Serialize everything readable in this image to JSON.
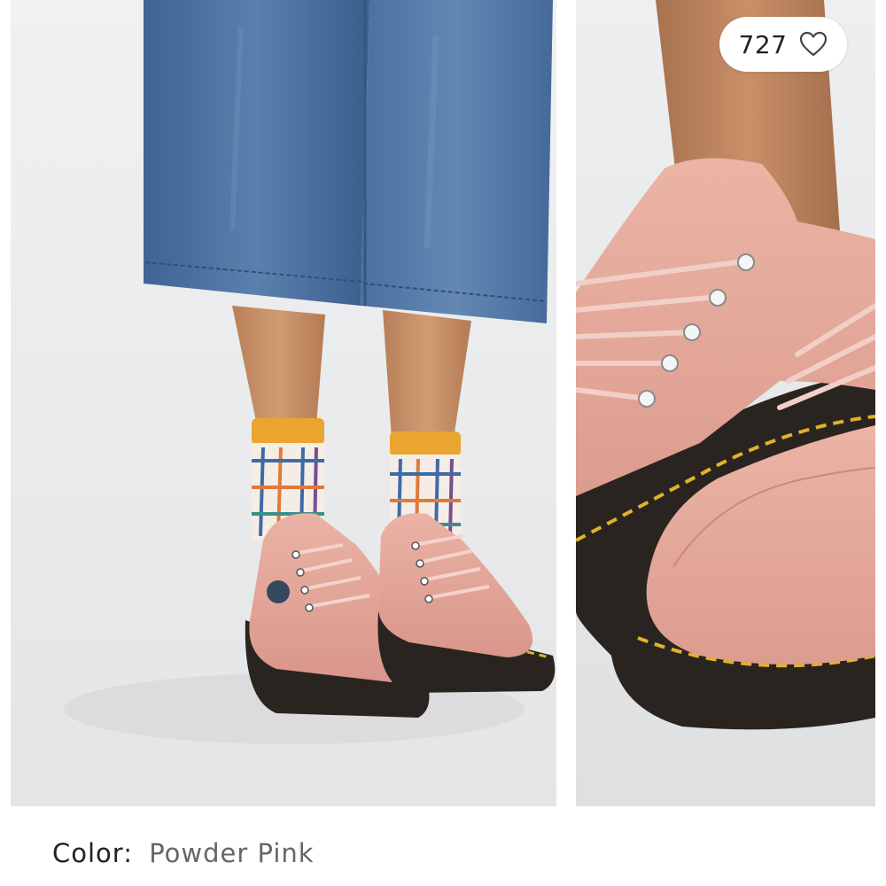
{
  "gallery": {
    "images": [
      {
        "name": "product-photo-main",
        "icon": "product-photo"
      },
      {
        "name": "product-photo-detail",
        "icon": "product-photo"
      }
    ],
    "like": {
      "count": "727",
      "icon": "heart-outline-icon"
    }
  },
  "product": {
    "color_label": "Color:",
    "color_value": "Powder Pink"
  },
  "colors": {
    "shoe": "#e8a99a",
    "sole": "#2a2421",
    "stitch": "#e2b12a",
    "denim": "#4c71a0",
    "sock_cuff": "#e9a52f",
    "background": "#ecedee"
  }
}
